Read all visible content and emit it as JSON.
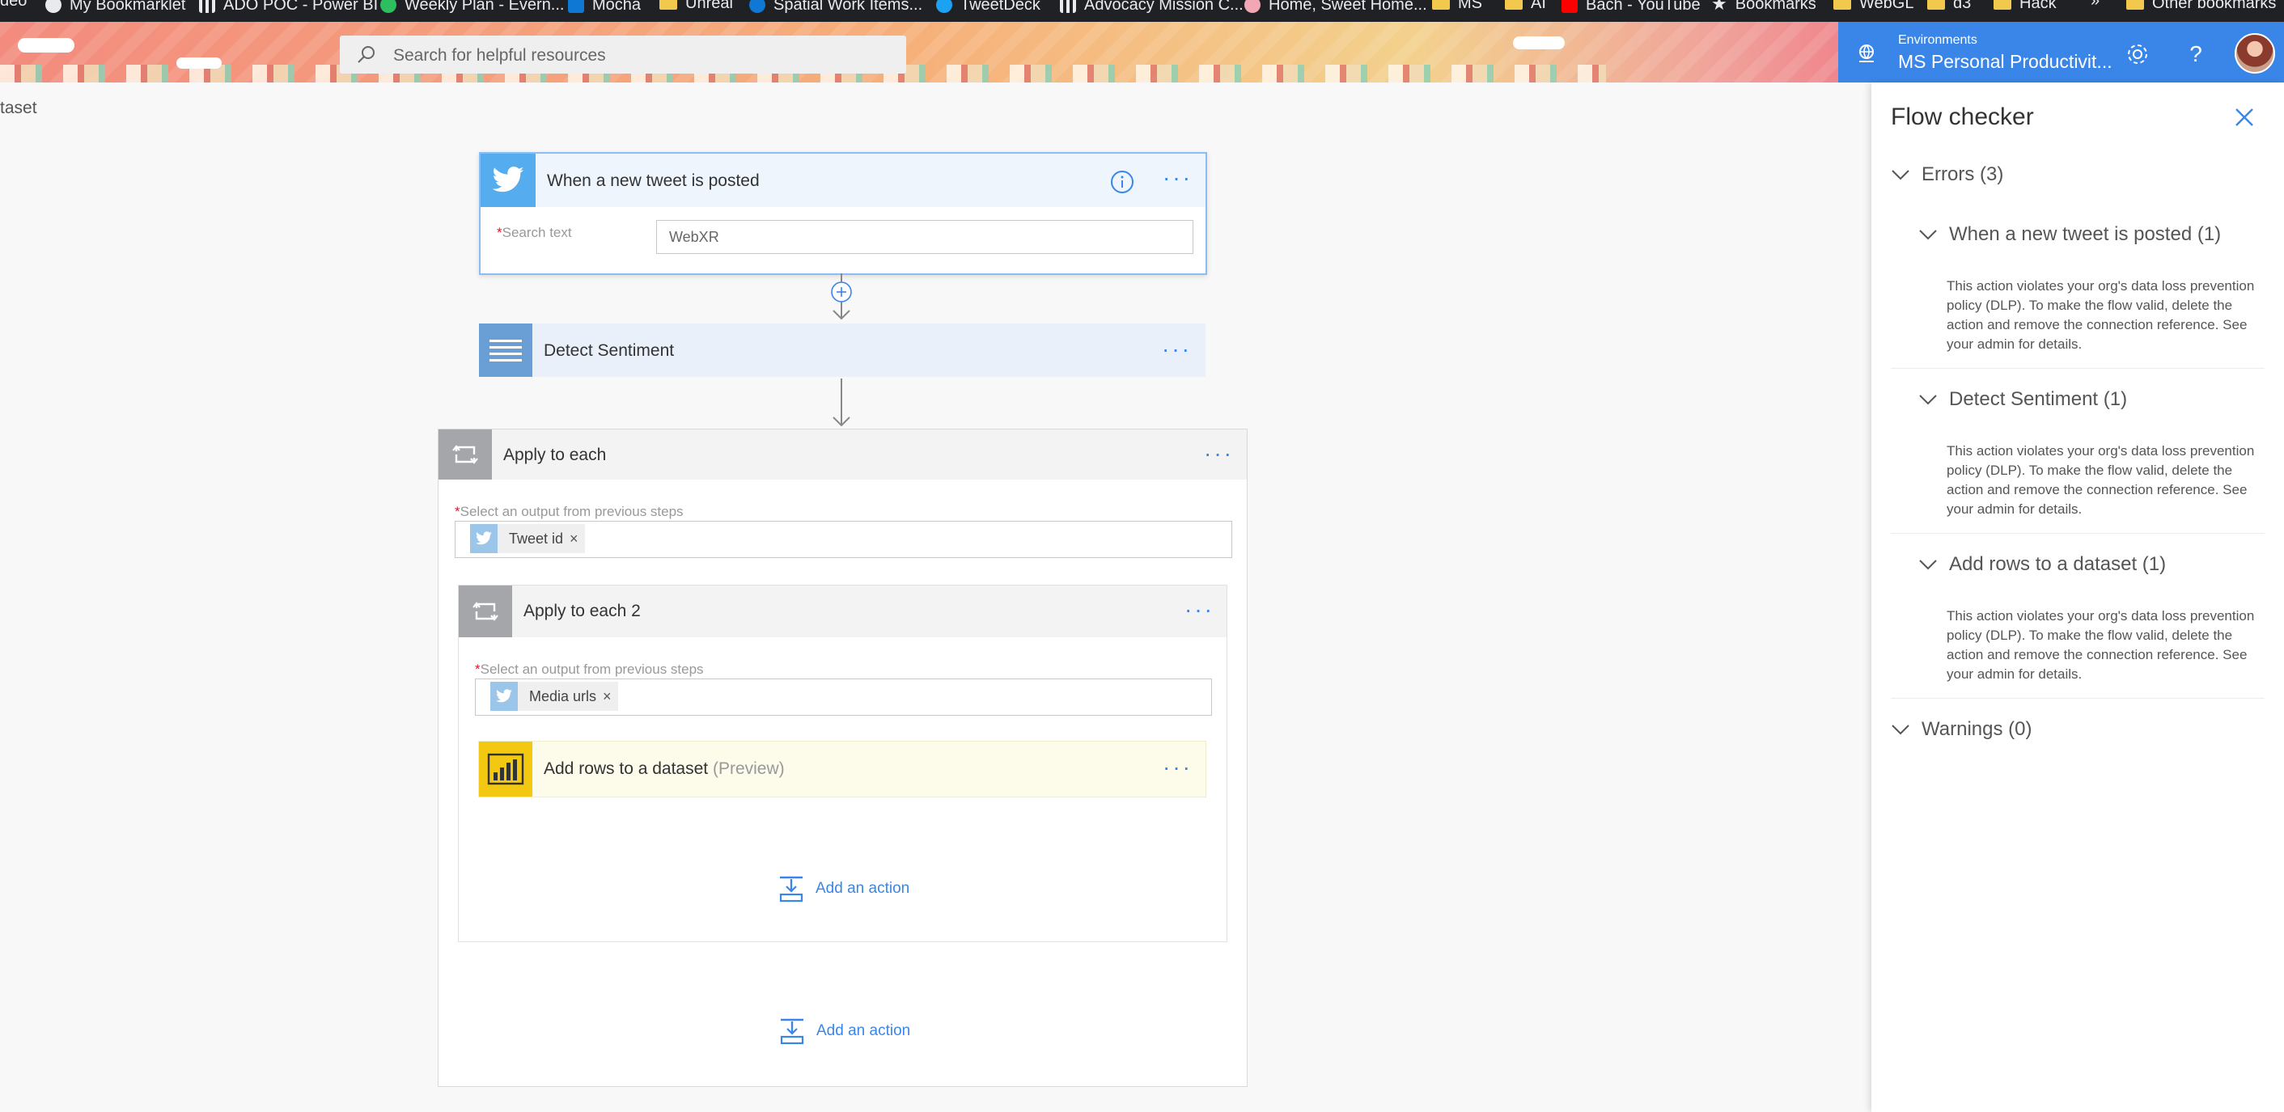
{
  "bookmarks": [
    {
      "label": "deo",
      "icon": "none"
    },
    {
      "label": "My Bookmarklet",
      "icon": "globe-icon"
    },
    {
      "label": "ADO POC - Power BI",
      "icon": "bars-icon"
    },
    {
      "label": "Weekly Plan - Evern...",
      "icon": "evernote-icon"
    },
    {
      "label": "Mocha",
      "icon": "outlook-icon"
    },
    {
      "label": "Unreal",
      "icon": "folder-icon"
    },
    {
      "label": "Spatial Work Items...",
      "icon": "azure-devops-icon"
    },
    {
      "label": "TweetDeck",
      "icon": "twitter-icon"
    },
    {
      "label": "Advocacy Mission C...",
      "icon": "bars-icon"
    },
    {
      "label": "Home, Sweet Home...",
      "icon": "pig-icon"
    },
    {
      "label": "MS",
      "icon": "folder-icon"
    },
    {
      "label": "AI",
      "icon": "folder-icon"
    },
    {
      "label": "Bach - YouTube",
      "icon": "youtube-icon"
    },
    {
      "label": "Bookmarks",
      "icon": "star-icon"
    },
    {
      "label": "WebGL",
      "icon": "folder-icon"
    },
    {
      "label": "d3",
      "icon": "folder-icon"
    },
    {
      "label": "Hack",
      "icon": "folder-icon"
    },
    {
      "label": "»",
      "icon": "none"
    },
    {
      "label": "Other bookmarks",
      "icon": "folder-icon"
    }
  ],
  "header": {
    "search_placeholder": "Search for helpful resources",
    "environments_label": "Environments",
    "environment_name": "MS Personal Productivit..."
  },
  "breadcrumb": "taset",
  "flow": {
    "trigger": {
      "title": "When a new tweet is posted",
      "field_label": "Search text",
      "field_value": "WebXR",
      "required_mark": "*"
    },
    "detect": {
      "title": "Detect Sentiment"
    },
    "apply1": {
      "title": "Apply to each",
      "field_label": "Select an output from previous steps",
      "token": "Tweet id",
      "required_mark": "*"
    },
    "apply2": {
      "title": "Apply to each 2",
      "field_label": "Select an output from previous steps",
      "token": "Media urls",
      "required_mark": "*"
    },
    "addrows": {
      "title": "Add rows to a dataset",
      "suffix": "(Preview)"
    },
    "add_action_label": "Add an action",
    "more_label": "···",
    "token_remove": "×"
  },
  "checker": {
    "title": "Flow checker",
    "errors_label": "Errors (3)",
    "errors": [
      {
        "title": "When a new tweet is posted (1)",
        "message": "This action violates your org's data loss prevention policy (DLP). To make the flow valid, delete the action and remove the connection reference. See your admin for details."
      },
      {
        "title": "Detect Sentiment (1)",
        "message": "This action violates your org's data loss prevention policy (DLP). To make the flow valid, delete the action and remove the connection reference. See your admin for details."
      },
      {
        "title": "Add rows to a dataset (1)",
        "message": "This action violates your org's data loss prevention policy (DLP). To make the flow valid, delete the action and remove the connection reference. See your admin for details."
      }
    ],
    "warnings_label": "Warnings (0)"
  },
  "colors": {
    "accent": "#3a86e8",
    "twitter": "#55acee",
    "detect": "#6a9fd6",
    "loop": "#a4a6aa",
    "powerbi": "#f2c811"
  }
}
